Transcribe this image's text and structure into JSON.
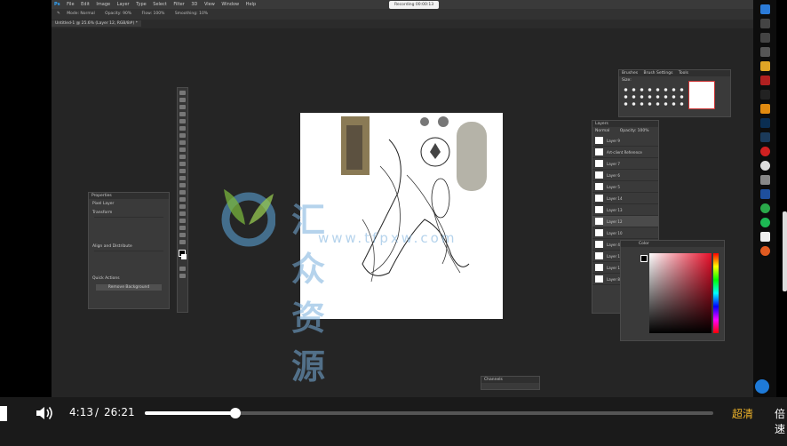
{
  "photoshop": {
    "menus": [
      "File",
      "Edit",
      "Image",
      "Layer",
      "Type",
      "Select",
      "Filter",
      "3D",
      "View",
      "Window",
      "Help"
    ],
    "options_bar": [
      "Mode: Normal",
      "Opacity: 90%",
      "Flow: 100%",
      "Smoothing: 10%"
    ],
    "document_tab": "Untitled-1 @ 25.6% (Layer 12, RGB/8#) *",
    "recording_badge": "Recording 00:00:13",
    "properties_panel": {
      "title": "Properties",
      "layer_name": "Pixel Layer",
      "sections": [
        "Transform",
        "Align and Distribute",
        "Quick Actions"
      ],
      "quick_action_button": "Remove Background"
    },
    "brushes_panel": {
      "tabs": [
        "Brushes",
        "Brush Settings",
        "Tools"
      ],
      "size_label": "Size:"
    },
    "layers_panel": {
      "title": "Layers",
      "blend_mode": "Normal",
      "opacity_label": "Opacity: 100%",
      "layers": [
        "Layer 9",
        "Art-client Reference",
        "Layer 7",
        "Layer 6",
        "Layer 5",
        "Layer 14",
        "Layer 13",
        "Layer 12",
        "Layer 10",
        "Layer 4",
        "Layer 17",
        "Layer 16",
        "Layer 8"
      ]
    },
    "color_panel": {
      "title": "Color"
    },
    "channels_panel": {
      "title": "Channels"
    }
  },
  "watermark": {
    "text": "汇众资源网",
    "url": "www.tfpxw.com"
  },
  "player": {
    "current_time": "4:13",
    "separator": "/",
    "total_time": "26:21",
    "progress": 0.16,
    "quality_label": "超清",
    "speed_label": "倍速"
  },
  "colors": {
    "accent_quality": "#f0b429",
    "taskbar": "#0d0d0d"
  }
}
